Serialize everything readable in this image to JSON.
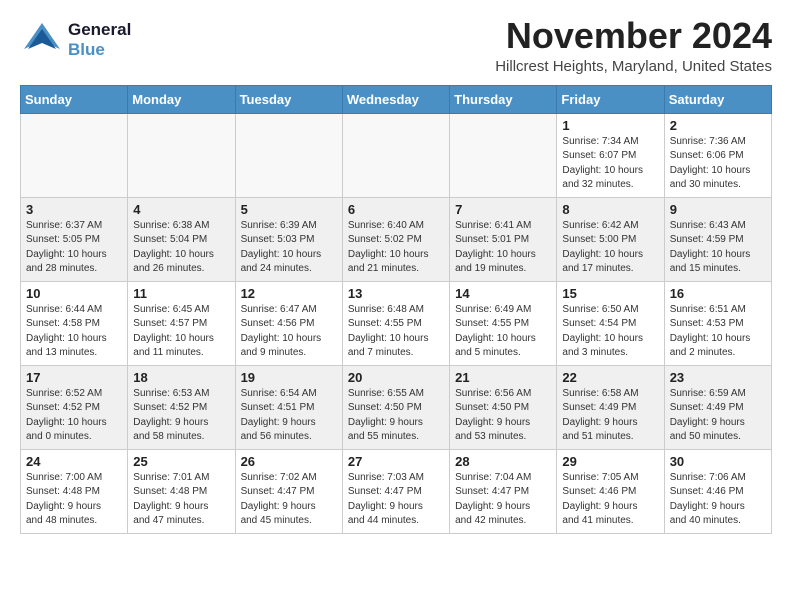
{
  "header": {
    "logo_line1": "General",
    "logo_line2": "Blue",
    "month": "November 2024",
    "location": "Hillcrest Heights, Maryland, United States"
  },
  "weekdays": [
    "Sunday",
    "Monday",
    "Tuesday",
    "Wednesday",
    "Thursday",
    "Friday",
    "Saturday"
  ],
  "weeks": [
    [
      {
        "day": "",
        "info": ""
      },
      {
        "day": "",
        "info": ""
      },
      {
        "day": "",
        "info": ""
      },
      {
        "day": "",
        "info": ""
      },
      {
        "day": "",
        "info": ""
      },
      {
        "day": "1",
        "info": "Sunrise: 7:34 AM\nSunset: 6:07 PM\nDaylight: 10 hours\nand 32 minutes."
      },
      {
        "day": "2",
        "info": "Sunrise: 7:36 AM\nSunset: 6:06 PM\nDaylight: 10 hours\nand 30 minutes."
      }
    ],
    [
      {
        "day": "3",
        "info": "Sunrise: 6:37 AM\nSunset: 5:05 PM\nDaylight: 10 hours\nand 28 minutes."
      },
      {
        "day": "4",
        "info": "Sunrise: 6:38 AM\nSunset: 5:04 PM\nDaylight: 10 hours\nand 26 minutes."
      },
      {
        "day": "5",
        "info": "Sunrise: 6:39 AM\nSunset: 5:03 PM\nDaylight: 10 hours\nand 24 minutes."
      },
      {
        "day": "6",
        "info": "Sunrise: 6:40 AM\nSunset: 5:02 PM\nDaylight: 10 hours\nand 21 minutes."
      },
      {
        "day": "7",
        "info": "Sunrise: 6:41 AM\nSunset: 5:01 PM\nDaylight: 10 hours\nand 19 minutes."
      },
      {
        "day": "8",
        "info": "Sunrise: 6:42 AM\nSunset: 5:00 PM\nDaylight: 10 hours\nand 17 minutes."
      },
      {
        "day": "9",
        "info": "Sunrise: 6:43 AM\nSunset: 4:59 PM\nDaylight: 10 hours\nand 15 minutes."
      }
    ],
    [
      {
        "day": "10",
        "info": "Sunrise: 6:44 AM\nSunset: 4:58 PM\nDaylight: 10 hours\nand 13 minutes."
      },
      {
        "day": "11",
        "info": "Sunrise: 6:45 AM\nSunset: 4:57 PM\nDaylight: 10 hours\nand 11 minutes."
      },
      {
        "day": "12",
        "info": "Sunrise: 6:47 AM\nSunset: 4:56 PM\nDaylight: 10 hours\nand 9 minutes."
      },
      {
        "day": "13",
        "info": "Sunrise: 6:48 AM\nSunset: 4:55 PM\nDaylight: 10 hours\nand 7 minutes."
      },
      {
        "day": "14",
        "info": "Sunrise: 6:49 AM\nSunset: 4:55 PM\nDaylight: 10 hours\nand 5 minutes."
      },
      {
        "day": "15",
        "info": "Sunrise: 6:50 AM\nSunset: 4:54 PM\nDaylight: 10 hours\nand 3 minutes."
      },
      {
        "day": "16",
        "info": "Sunrise: 6:51 AM\nSunset: 4:53 PM\nDaylight: 10 hours\nand 2 minutes."
      }
    ],
    [
      {
        "day": "17",
        "info": "Sunrise: 6:52 AM\nSunset: 4:52 PM\nDaylight: 10 hours\nand 0 minutes."
      },
      {
        "day": "18",
        "info": "Sunrise: 6:53 AM\nSunset: 4:52 PM\nDaylight: 9 hours\nand 58 minutes."
      },
      {
        "day": "19",
        "info": "Sunrise: 6:54 AM\nSunset: 4:51 PM\nDaylight: 9 hours\nand 56 minutes."
      },
      {
        "day": "20",
        "info": "Sunrise: 6:55 AM\nSunset: 4:50 PM\nDaylight: 9 hours\nand 55 minutes."
      },
      {
        "day": "21",
        "info": "Sunrise: 6:56 AM\nSunset: 4:50 PM\nDaylight: 9 hours\nand 53 minutes."
      },
      {
        "day": "22",
        "info": "Sunrise: 6:58 AM\nSunset: 4:49 PM\nDaylight: 9 hours\nand 51 minutes."
      },
      {
        "day": "23",
        "info": "Sunrise: 6:59 AM\nSunset: 4:49 PM\nDaylight: 9 hours\nand 50 minutes."
      }
    ],
    [
      {
        "day": "24",
        "info": "Sunrise: 7:00 AM\nSunset: 4:48 PM\nDaylight: 9 hours\nand 48 minutes."
      },
      {
        "day": "25",
        "info": "Sunrise: 7:01 AM\nSunset: 4:48 PM\nDaylight: 9 hours\nand 47 minutes."
      },
      {
        "day": "26",
        "info": "Sunrise: 7:02 AM\nSunset: 4:47 PM\nDaylight: 9 hours\nand 45 minutes."
      },
      {
        "day": "27",
        "info": "Sunrise: 7:03 AM\nSunset: 4:47 PM\nDaylight: 9 hours\nand 44 minutes."
      },
      {
        "day": "28",
        "info": "Sunrise: 7:04 AM\nSunset: 4:47 PM\nDaylight: 9 hours\nand 42 minutes."
      },
      {
        "day": "29",
        "info": "Sunrise: 7:05 AM\nSunset: 4:46 PM\nDaylight: 9 hours\nand 41 minutes."
      },
      {
        "day": "30",
        "info": "Sunrise: 7:06 AM\nSunset: 4:46 PM\nDaylight: 9 hours\nand 40 minutes."
      }
    ]
  ]
}
